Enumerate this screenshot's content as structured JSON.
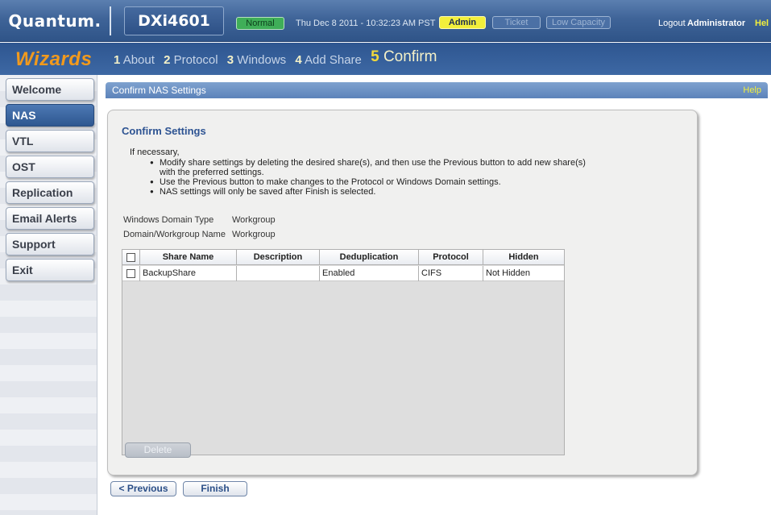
{
  "header": {
    "logo": "Quantum.",
    "model": "DXi4601",
    "status": "Normal",
    "datetime": "Thu Dec 8 2011 - 10:32:23 AM PST",
    "role": "Admin",
    "ticket": "Ticket",
    "capacity": "Low Capacity",
    "logout": "Logout",
    "user": "Administrator",
    "help": "Hel"
  },
  "wizard": {
    "title": "Wizards",
    "steps": [
      {
        "num": "1",
        "label": "About"
      },
      {
        "num": "2",
        "label": "Protocol"
      },
      {
        "num": "3",
        "label": "Windows"
      },
      {
        "num": "4",
        "label": "Add Share"
      },
      {
        "num": "5",
        "label": "Confirm"
      }
    ]
  },
  "sidebar": {
    "items": [
      "Welcome",
      "NAS",
      "VTL",
      "OST",
      "Replication",
      "Email Alerts",
      "Support",
      "Exit"
    ]
  },
  "panel": {
    "title": "Confirm NAS Settings",
    "help": "Help"
  },
  "confirm": {
    "title": "Confirm Settings",
    "intro": "If necessary,",
    "bullets": [
      "Modify share settings by deleting the desired share(s), and then use the Previous button to add new share(s) with the preferred settings.",
      "Use the Previous button to make changes to the Protocol or Windows Domain settings.",
      "NAS settings will only be saved after Finish is selected."
    ],
    "domain_type_label": "Windows Domain Type",
    "domain_type_value": "Workgroup",
    "domain_name_label": "Domain/Workgroup Name",
    "domain_name_value": "Workgroup"
  },
  "table": {
    "columns": [
      "Share Name",
      "Description",
      "Deduplication",
      "Protocol",
      "Hidden"
    ],
    "rows": [
      {
        "share_name": "BackupShare",
        "description": "",
        "dedup": "Enabled",
        "protocol": "CIFS",
        "hidden": "Not Hidden"
      }
    ]
  },
  "buttons": {
    "delete": "Delete",
    "previous": "< Previous",
    "finish": "Finish"
  }
}
